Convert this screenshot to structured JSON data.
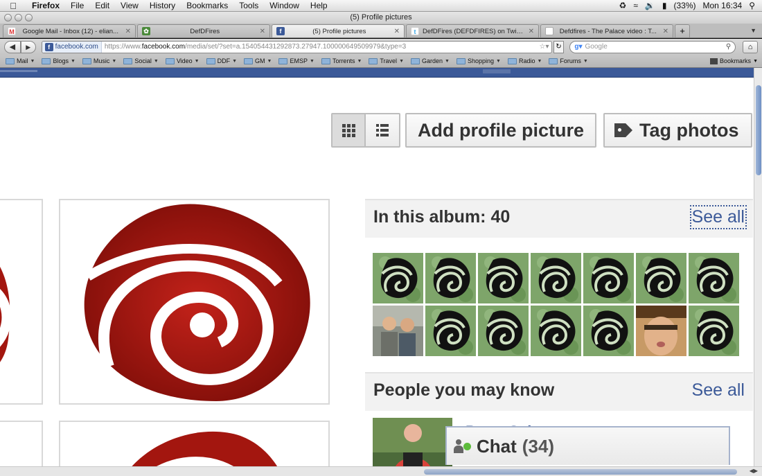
{
  "menubar": {
    "app": "Firefox",
    "items": [
      "File",
      "Edit",
      "View",
      "History",
      "Bookmarks",
      "Tools",
      "Window",
      "Help"
    ],
    "battery": "(33%)",
    "clock": "Mon 16:34"
  },
  "window": {
    "title": "(5) Profile pictures"
  },
  "tabs": [
    {
      "title": "Google Mail - Inbox (12) - elian...",
      "icon": "gmail-icon",
      "active": false
    },
    {
      "title": "DefDFires",
      "icon": "green-site-icon",
      "active": false
    },
    {
      "title": "(5) Profile pictures",
      "icon": "facebook-icon",
      "active": true
    },
    {
      "title": "DefDFires (DEFDFIRES) on Twitter",
      "icon": "twitter-icon",
      "active": false
    },
    {
      "title": "Defdfires - The Palace video : T...",
      "icon": "document-icon",
      "active": false
    }
  ],
  "navbar": {
    "site_badge": "facebook.com",
    "url_prefix": "https://www.",
    "url_domain": "facebook.com",
    "url_rest": "/media/set/?set=a.154054431292873.27947.100000649509979&type=3",
    "search_placeholder": "Google"
  },
  "bookmarks": [
    "Mail",
    "Blogs",
    "Music",
    "Social",
    "Video",
    "DDF",
    "GM",
    "EMSP",
    "Torrents",
    "Travel",
    "Garden",
    "Shopping",
    "Radio",
    "Forums"
  ],
  "bookmarks_menu": "Bookmarks",
  "actions": {
    "add_profile_picture": "Add profile picture",
    "tag_photos": "Tag photos"
  },
  "album": {
    "title": "In this album: 40",
    "see_all": "See all"
  },
  "people": {
    "title": "People you may know",
    "see_all": "See all",
    "first_name": "Perry Sch..."
  },
  "chat": {
    "label": "Chat",
    "count": "(34)"
  },
  "colors": {
    "facebook_blue": "#3b5998",
    "logo_red": "#a3160f",
    "thumb_green": "#6e9a5a"
  }
}
